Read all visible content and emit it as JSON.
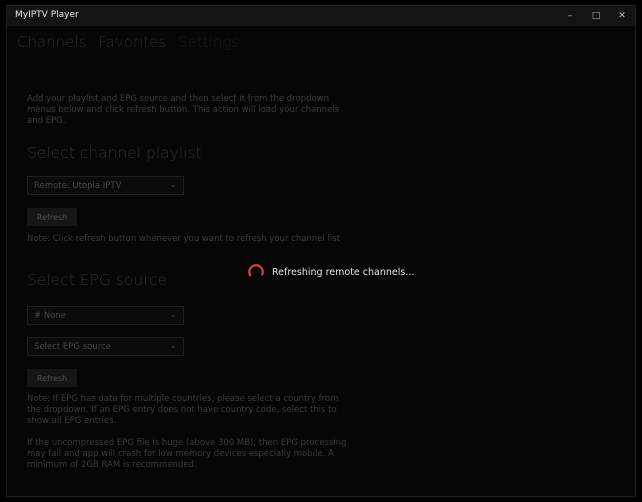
{
  "window": {
    "title": "MyIPTV Player",
    "controls": {
      "minimize": "–",
      "maximize": "□",
      "close": "✕"
    }
  },
  "tabs": [
    {
      "label": "Channels",
      "active": false
    },
    {
      "label": "Favorites",
      "active": false
    },
    {
      "label": "Settings",
      "active": true
    }
  ],
  "settings": {
    "description": "Add your playlist and EPG source and then select it from the dropdown menus below and click refresh button. This action will load your channels and EPG.",
    "channel_section": {
      "heading": "Select channel playlist",
      "selected_playlist": "Remote: Utopia IPTV",
      "refresh_label": "Refresh",
      "note": "Note: Click refresh button whenever you want to refresh your channel list"
    },
    "epg_section": {
      "heading": "Select EPG source",
      "country_value": "# None",
      "epg_source_placeholder": "Select EPG source",
      "refresh_label": "Refresh",
      "note1": "Note: If EPG has data for multiple countries, please select a country from the dropdown. If an EPG entry does not have country code, select this to show all EPG entries.",
      "note2": "If the uncompressed EPG file is huge (above 300 MB), then EPG processing may fail and app will crash for low memory devices especially mobile. A minimum of 2GB RAM is recommended."
    }
  },
  "overlay": {
    "loading_text": "Refreshing remote channels..."
  },
  "colors": {
    "spinner_accent": "#d9442f",
    "window_bg": "#0a0a0a"
  }
}
